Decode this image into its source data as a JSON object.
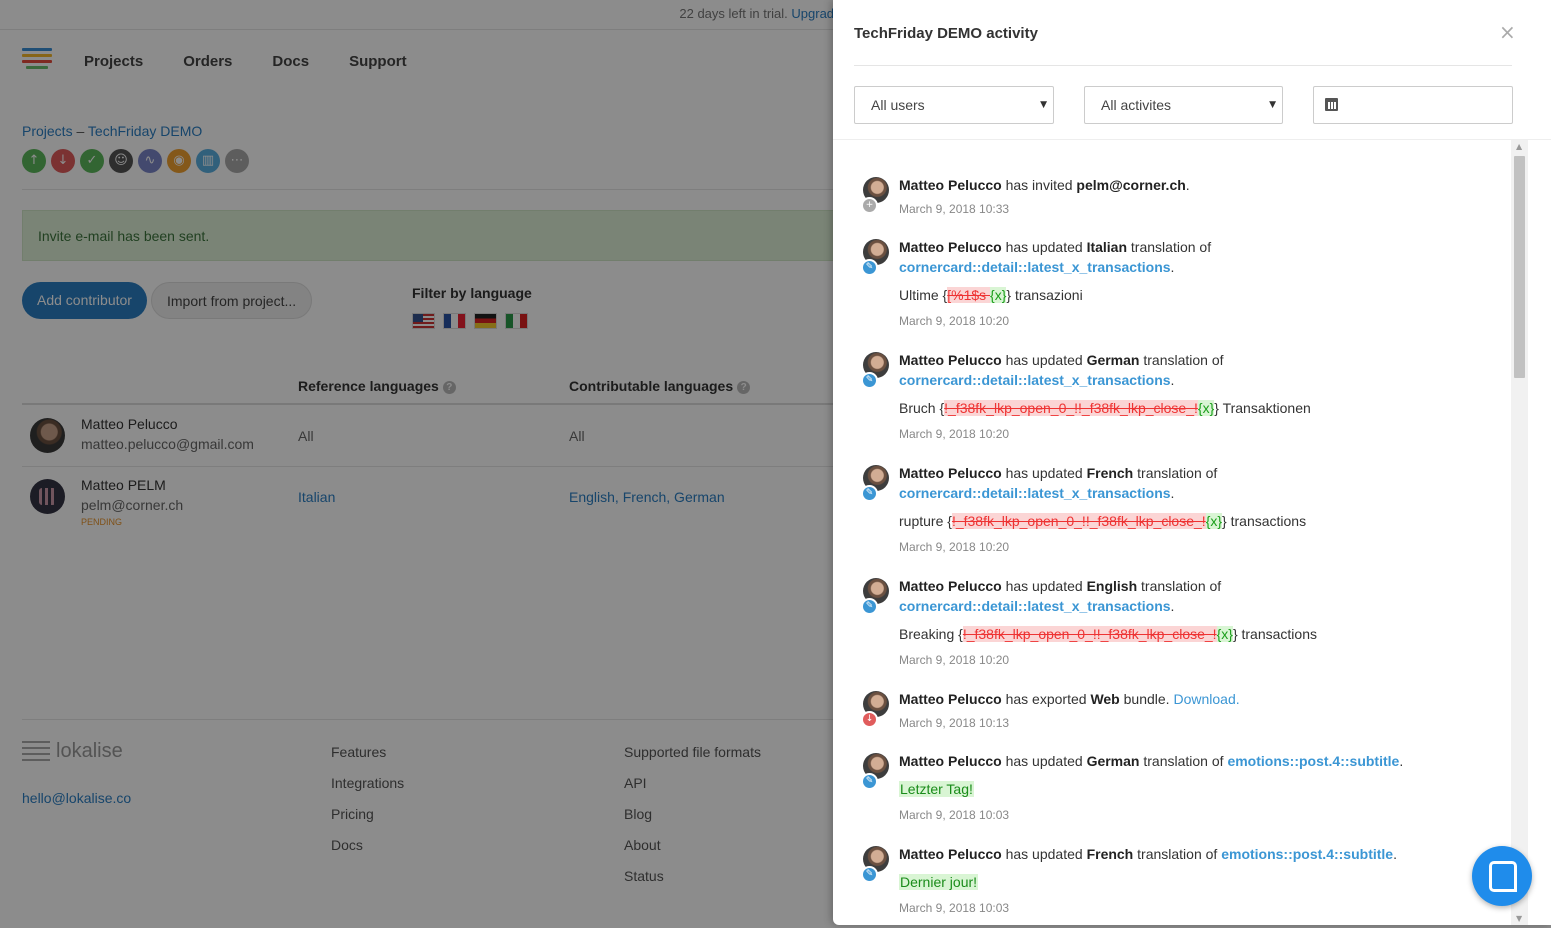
{
  "trial": {
    "text": "22 days left in trial.",
    "upgrade": "Upgrade now."
  },
  "nav": {
    "items": [
      "Projects",
      "Orders",
      "Docs",
      "Support"
    ]
  },
  "breadcrumb": {
    "root": "Projects",
    "sep": "–",
    "current": "TechFriday DEMO"
  },
  "project_icons": [
    {
      "icon": "upload-icon",
      "glyph": "↑",
      "color": "#5cb85c"
    },
    {
      "icon": "download-icon",
      "glyph": "↓",
      "color": "#e05c5c"
    },
    {
      "icon": "check-icon",
      "glyph": "✓",
      "color": "#5cb85c"
    },
    {
      "icon": "contributors-icon",
      "glyph": "☺",
      "color": "#555555"
    },
    {
      "icon": "activity-icon",
      "glyph": "∿",
      "color": "#7b86c8"
    },
    {
      "icon": "screenshots-icon",
      "glyph": "◉",
      "color": "#f0a030"
    },
    {
      "icon": "book-icon",
      "glyph": "▥",
      "color": "#5aafe0"
    },
    {
      "icon": "more-icon",
      "glyph": "⋯",
      "color": "#aaaaaa"
    }
  ],
  "alert": {
    "text": "Invite e-mail has been sent."
  },
  "buttons": {
    "add_contributor": "Add contributor",
    "import_project": "Import from project..."
  },
  "filter": {
    "label": "Filter by language",
    "flags": [
      "flag-us-icon",
      "flag-fr-icon",
      "flag-de-icon",
      "flag-it-icon"
    ]
  },
  "table": {
    "col_reference": "Reference languages",
    "col_contrib": "Contributable languages",
    "rows": [
      {
        "name": "Matteo Pelucco",
        "email": "matteo.pelucco@gmail.com",
        "status": "",
        "reference": "All",
        "contributable": "All"
      },
      {
        "name": "Matteo PELM",
        "email": "pelm@corner.ch",
        "status": "PENDING",
        "reference": "Italian",
        "contributable": "English, French, German"
      }
    ]
  },
  "footer": {
    "brand": "lokalise",
    "email": "hello@lokalise.co",
    "col1": [
      "Features",
      "Integrations",
      "Pricing",
      "Docs"
    ],
    "col2": [
      "Supported file formats",
      "API",
      "Blog",
      "About",
      "Status"
    ]
  },
  "drawer": {
    "title": "TechFriday DEMO activity",
    "close": "×",
    "users_select": "All users",
    "activities_select": "All activites",
    "date_value": "",
    "caret": "▼"
  },
  "entries": [
    {
      "user": "Matteo Pelucco",
      "verb": "has invited",
      "obj": "pelm@corner.ch",
      "tail": ".",
      "date": "March 9, 2018 10:33"
    },
    {
      "user": "Matteo Pelucco",
      "verb": "has updated",
      "lang": "Italian",
      "mid": "translation of",
      "key": "cornercard::detail::latest_x_transactions",
      "pre": "Ultime {",
      "del": "[%1$s ",
      "ins": "{x}",
      "post": "} transazioni",
      "date": "March 9, 2018 10:20"
    },
    {
      "user": "Matteo Pelucco",
      "verb": "has updated",
      "lang": "German",
      "mid": "translation of",
      "key": "cornercard::detail::latest_x_transactions",
      "pre": "Bruch {",
      "del": "!_f38fk_lkp_open_0_!!_f38fk_lkp_close_!",
      "ins": "{x}",
      "post": "} Transaktionen",
      "date": "March 9, 2018 10:20"
    },
    {
      "user": "Matteo Pelucco",
      "verb": "has updated",
      "lang": "French",
      "mid": "translation of",
      "key": "cornercard::detail::latest_x_transactions",
      "pre": "rupture {",
      "del": "!_f38fk_lkp_open_0_!!_f38fk_lkp_close_!",
      "ins": "{x}",
      "post": "} transactions",
      "date": "March 9, 2018 10:20"
    },
    {
      "user": "Matteo Pelucco",
      "verb": "has updated",
      "lang": "English",
      "mid": "translation of",
      "key": "cornercard::detail::latest_x_transactions",
      "pre": "Breaking {",
      "del": "!_f38fk_lkp_open_0_!!_f38fk_lkp_close_!",
      "ins": "{x}",
      "post": "} transactions",
      "date": "March 9, 2018 10:20"
    },
    {
      "user": "Matteo Pelucco",
      "verb": "has exported",
      "obj": "Web",
      "tail": "bundle.",
      "link": "Download.",
      "date": "March 9, 2018 10:13"
    },
    {
      "user": "Matteo Pelucco",
      "verb": "has updated",
      "lang": "German",
      "mid": "translation of",
      "key": "emotions::post.4::subtitle",
      "value": "Letzter Tag!",
      "date": "March 9, 2018 10:03"
    },
    {
      "user": "Matteo Pelucco",
      "verb": "has updated",
      "lang": "French",
      "mid": "translation of",
      "key": "emotions::post.4::subtitle",
      "value": "Dernier jour!",
      "date": "March 9, 2018 10:03"
    }
  ]
}
